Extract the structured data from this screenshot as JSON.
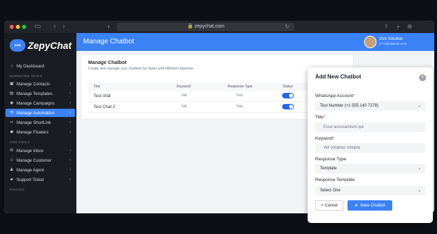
{
  "browser": {
    "url": "zepychat.com"
  },
  "brand": {
    "logo_text": "ZepyChat",
    "accent": "#3b82f6"
  },
  "sidebar": {
    "dashboard": "My Dashboard",
    "section_marketing": "MARKETING TOOLS",
    "marketing_items": [
      {
        "label": "Manage Contacts",
        "icon": "contacts-icon"
      },
      {
        "label": "Manage Templates",
        "icon": "templates-icon"
      },
      {
        "label": "Manage Campaigns",
        "icon": "campaign-icon"
      },
      {
        "label": "Manage Automation",
        "icon": "automation-icon",
        "active": true
      },
      {
        "label": "Manage ShortLink",
        "icon": "link-icon"
      },
      {
        "label": "Manage Floaters",
        "icon": "floater-icon"
      }
    ],
    "section_crm": "CRM TOOLS",
    "crm_items": [
      {
        "label": "Manage Inbox",
        "icon": "inbox-icon"
      },
      {
        "label": "Manage Customer",
        "icon": "customer-icon"
      },
      {
        "label": "Manage Agent",
        "icon": "agent-icon"
      },
      {
        "label": "Support Ticket",
        "icon": "ticket-icon"
      }
    ],
    "section_finance": "FINANCE"
  },
  "header": {
    "title": "Manage Chatbot",
    "user_name": "Ove Solution",
    "user_email": "o***@lubbock.com"
  },
  "chatbot_card": {
    "title": "Manage Chatbot",
    "description": "Create and manage your chatbots for faster and efficient response.",
    "columns": [
      "Title",
      "Keyword",
      "Response Type",
      "Status"
    ],
    "rows": [
      {
        "title": "Test chat",
        "keyword": "NA",
        "response_type": "Test",
        "status": true
      },
      {
        "title": "Test Chat 2",
        "keyword": "NA",
        "response_type": "Test",
        "status": true
      }
    ]
  },
  "modal": {
    "title": "Add New Chatbot",
    "whatsapp_label": "WhatsApp Account",
    "whatsapp_value": "Test Number (+1 555 140 7278)",
    "title_label": "Title",
    "title_value": "Esse accusantium qui",
    "keyword_label": "Keyword",
    "keyword_value": "Vel voluptas volupta",
    "response_type_label": "Response Type",
    "response_type_value": "Template",
    "response_template_label": "Response Template",
    "response_template_value": "Select One",
    "cancel_label": "Cancel",
    "save_label": "Save Chatbot"
  }
}
